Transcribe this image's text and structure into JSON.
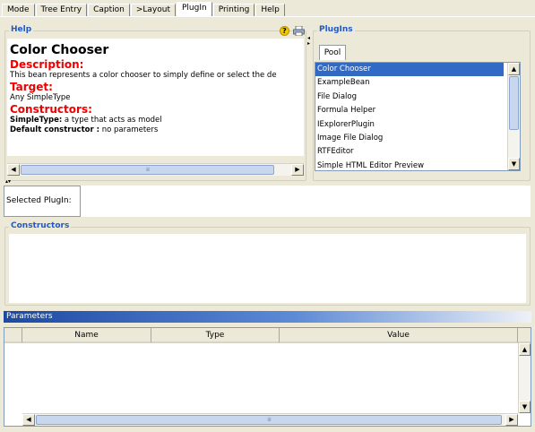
{
  "tabs": [
    "Mode",
    "Tree Entry",
    "Caption",
    ">Layout",
    "PlugIn",
    "Printing",
    "Help"
  ],
  "active_tab": "PlugIn",
  "help": {
    "group_title": "Help",
    "title": "Color Chooser",
    "description_heading": "Description:",
    "description_text": "This bean represents a color chooser to simply define or select the de",
    "target_heading": "Target:",
    "target_text": "Any SimpleType",
    "constructors_heading": "Constructors:",
    "ctor1_bold": "SimpleType:",
    "ctor1_text": " a type that acts as model",
    "ctor2_bold": "Default constructor :",
    "ctor2_text": " no parameters",
    "help_icon": "question-icon",
    "print_icon": "printer-icon"
  },
  "plugins": {
    "group_title": "PlugIns",
    "subtab": "Pool",
    "items": [
      "Color Chooser",
      "ExampleBean",
      "File Dialog",
      "Formula Helper",
      "IExplorerPlugin",
      "Image File Dialog",
      "RTFEditor",
      "Simple HTML Editor Preview"
    ],
    "selected_index": 0
  },
  "selected_plugin": {
    "label": "Selected PlugIn:",
    "value": ""
  },
  "constructors": {
    "group_title": "Constructors"
  },
  "parameters": {
    "header": "Parameters",
    "columns": [
      "Name",
      "Type",
      "Value"
    ]
  },
  "colors": {
    "accent": "#2159c7",
    "heading_red": "#e00000",
    "selection": "#316ac5",
    "header_gradient_start": "#1c4aa3"
  }
}
